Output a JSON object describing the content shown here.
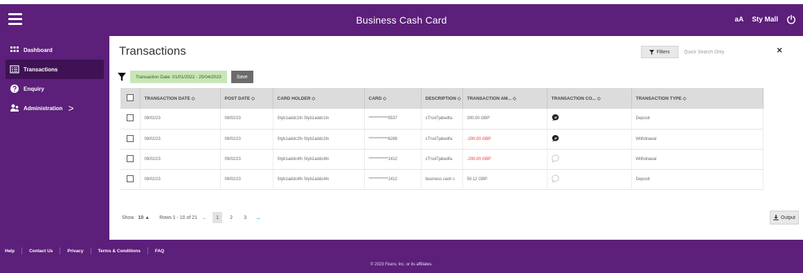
{
  "header": {
    "title": "Business Cash Card",
    "font_toggle": "aA",
    "user_name": "Sty Mall"
  },
  "sidebar": {
    "items": [
      {
        "label": "Dashboard",
        "icon": "grid-icon"
      },
      {
        "label": "Transactions",
        "icon": "list-icon",
        "active": true
      },
      {
        "label": "Enquiry",
        "icon": "help-icon"
      },
      {
        "label": "Administration",
        "icon": "users-icon",
        "chevron": ">"
      }
    ]
  },
  "main": {
    "title": "Transactions",
    "filters_label": "Filters",
    "search_placeholder": "Quick Search Only",
    "close_symbol": "×",
    "active_filter": "Transaction Date: 01/01/2022 - 25/04/2023",
    "save_label": "Save"
  },
  "table": {
    "columns": [
      "TRANSACTION DATE",
      "POST DATE",
      "CARD HOLDER",
      "CARD",
      "DESCRIPTION",
      "TRANSACTION AM...",
      "TRANSACTION CO...",
      "TRANSACTION TYPE"
    ],
    "sort_glyph": "◇",
    "rows": [
      {
        "transaction_date": "09/02/23",
        "post_date": "09/02/23",
        "card_holder": "Styb1addc1fn Styb1addc1ln",
        "card": "************9537",
        "description": "sT!sxl7jabedfa",
        "amount": "200.00 GBP",
        "comment": "filled",
        "type": "Deposit"
      },
      {
        "transaction_date": "09/02/23",
        "post_date": "09/02/23",
        "card_holder": "Styb1addc2fn Styb1addc2ln",
        "card": "************6288",
        "description": "sT!sxl7jabedfa",
        "amount": "-200.00 GBP",
        "comment": "filled",
        "type": "Withdrawal"
      },
      {
        "transaction_date": "09/02/23",
        "post_date": "09/02/23",
        "card_holder": "Styb1addc4fn Styb1addc4ln",
        "card": "************1412",
        "description": "sT!sxl7jabedfa",
        "amount": "-200.00 GBP",
        "comment": "empty",
        "type": "Withdrawal"
      },
      {
        "transaction_date": "09/02/23",
        "post_date": "09/02/23",
        "card_holder": "Styb1addc4fn Styb1addc4ln",
        "card": "************1412",
        "description": "business cash c",
        "amount": "50.12 GBP",
        "comment": "empty",
        "type": "Deposit"
      }
    ]
  },
  "pagination": {
    "show_label": "Show",
    "page_size": "10",
    "size_arrow": "▲",
    "rows_info": "Rows 1 - 10 of 21",
    "prev_arrow": "←",
    "pages": [
      "1",
      "2",
      "3"
    ],
    "next_arrow": "→",
    "current_page": "1"
  },
  "output_label": "Output",
  "footer": {
    "links": [
      "Help",
      "Contact Us",
      "Privacy",
      "Terms & Conditions",
      "FAQ"
    ],
    "copyright": "© 2023 Fiserv, Inc. or its affiliates."
  },
  "colors": {
    "brand_purple": "#5c1f7a",
    "active_item": "#3e1254",
    "filter_chip": "#c8e6b8",
    "negative": "#e03a3a",
    "next_arrow": "#1aa3e8"
  }
}
